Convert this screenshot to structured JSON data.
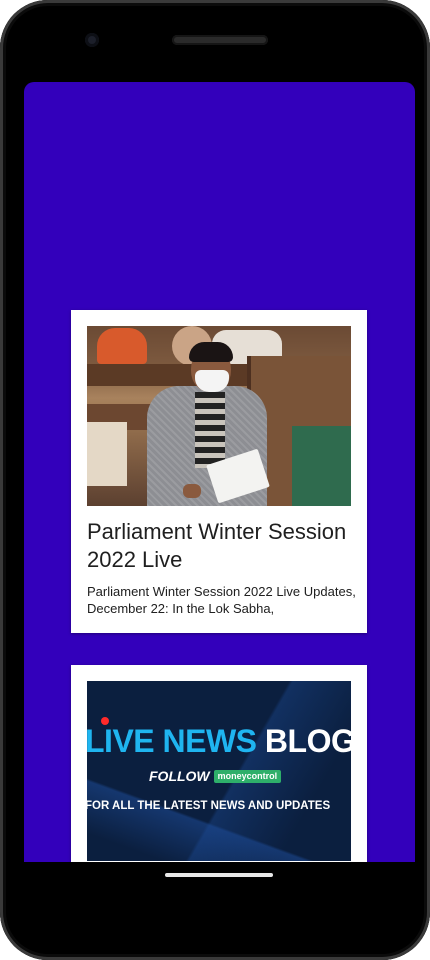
{
  "feed": {
    "cards": [
      {
        "title": "Parliament Winter Session 2022 Live",
        "description": "Parliament Winter Session 2022 Live Updates, December 22: In the Lok Sabha,",
        "image_icon": "parliament-photo"
      },
      {
        "image_icon": "live-news-blog-banner",
        "banner": {
          "live": "LIVE NEWS",
          "blog": "BLOG",
          "follow": "FOLLOW",
          "brand": "moneycontrol",
          "tagline": "FOR ALL THE LATEST NEWS AND UPDATES"
        }
      }
    ]
  },
  "colors": {
    "screen_background": "#3300bb",
    "card_background": "#ffffff",
    "live_text": "#1fb5f0",
    "brand_badge": "#2eaf6a"
  }
}
